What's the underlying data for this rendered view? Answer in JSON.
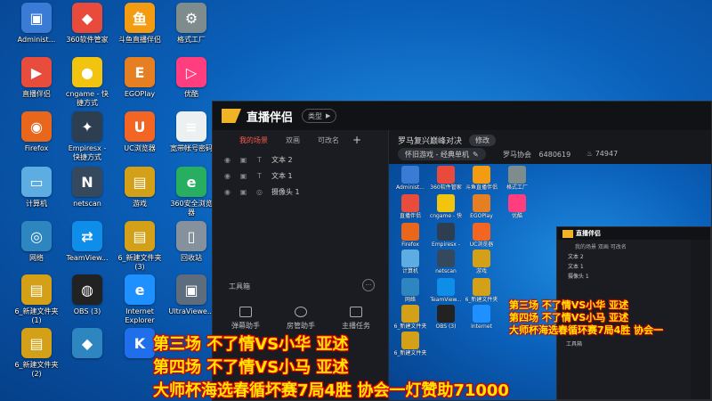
{
  "desktop": {
    "icons": [
      {
        "label": "Administ...",
        "glyph": "▣",
        "color": "#3a7bd5"
      },
      {
        "label": "360软件管家",
        "glyph": "◆",
        "color": "#e84b3c"
      },
      {
        "label": "斗鱼直播伴侣",
        "glyph": "鱼",
        "color": "#f39c12"
      },
      {
        "label": "格式工厂",
        "glyph": "⚙",
        "color": "#7f8c8d"
      },
      {
        "label": "直播伴侣",
        "glyph": "▶",
        "color": "#e74c3c"
      },
      {
        "label": "cngame - 快\n捷方式",
        "glyph": "●",
        "color": "#f1c40f"
      },
      {
        "label": "EGOPlay",
        "glyph": "E",
        "color": "#e67e22"
      },
      {
        "label": "优酷",
        "glyph": "▷",
        "color": "#ff3d7f"
      },
      {
        "label": "Firefox",
        "glyph": "◉",
        "color": "#e8671d"
      },
      {
        "label": "Empiresx -\n快捷方式",
        "glyph": "✦",
        "color": "#2c3e50"
      },
      {
        "label": "UC浏览器",
        "glyph": "U",
        "color": "#f26522"
      },
      {
        "label": "宽带帐号密码",
        "glyph": "≡",
        "color": "#ecf0f1"
      },
      {
        "label": "计算机",
        "glyph": "▭",
        "color": "#5dade2"
      },
      {
        "label": "netscan",
        "glyph": "N",
        "color": "#34495e"
      },
      {
        "label": "游戏",
        "glyph": "▤",
        "color": "#d4a017"
      },
      {
        "label": "360安全浏览\n器",
        "glyph": "e",
        "color": "#27ae60"
      },
      {
        "label": "网络",
        "glyph": "◎",
        "color": "#2e86c1"
      },
      {
        "label": "TeamView...",
        "glyph": "⇄",
        "color": "#0e8ee9"
      },
      {
        "label": "6_新建文件夹\n(3)",
        "glyph": "▤",
        "color": "#d4a017"
      },
      {
        "label": "回收站",
        "glyph": "▯",
        "color": "#85929e"
      },
      {
        "label": "6_新建文件夹\n(1)",
        "glyph": "▤",
        "color": "#d4a017"
      },
      {
        "label": "OBS (3)",
        "glyph": "◍",
        "color": "#222222"
      },
      {
        "label": "Internet\nExplorer",
        "glyph": "e",
        "color": "#1e90ff"
      },
      {
        "label": "UltraViewe...",
        "glyph": "▣",
        "color": "#5d6d7e"
      },
      {
        "label": "6_新建文件夹\n(2)",
        "glyph": "▤",
        "color": "#d4a017"
      },
      {
        "label": "",
        "glyph": "◆",
        "color": "#2e86c1"
      },
      {
        "label": "",
        "glyph": "K",
        "color": "#1f6feb"
      }
    ]
  },
  "app": {
    "brand": "直播伴侣",
    "type_button": "类型",
    "tabs": [
      "我的场景",
      "双画",
      "可改名"
    ],
    "plus": "+",
    "scenes": [
      {
        "label": "文本 2"
      },
      {
        "label": "文本 1"
      },
      {
        "label": "摄像头 1"
      }
    ],
    "tools_title": "工具箱",
    "tools_more": "···",
    "tools": [
      "弹幕助手",
      "房管助手",
      "主播任务"
    ],
    "room_title": "罗马复兴巅峰对决",
    "edit_label": "修改",
    "category": "怀旧游戏 - 经典单机",
    "guild": "罗马协会",
    "room_id": "6480619",
    "fans": "74947"
  },
  "preview": {
    "mini_brand": "直播伴侣",
    "mini_tabs": "我的场景  双画  可改名",
    "mini_scenes": [
      "文本 2",
      "文本 1",
      "摄像头 1"
    ],
    "mini_tools": "工具箱",
    "mini_overlay": [
      "第三场 不了情VS小华 亚述",
      "第四场 不了情VS小马 亚述",
      "大师杯海选春循环赛7局4胜 协会一"
    ]
  },
  "overlay": {
    "line1": "第三场 不了情VS小华  亚述",
    "line2": "第四场 不了情VS小马 亚述",
    "line3": "大师杯海选春循坏赛7局4胜 协会一灯赞助71000"
  },
  "colors": {
    "accent": "#ff5a4a",
    "overlay_text": "#ffe600",
    "overlay_outline": "#dd0000"
  }
}
